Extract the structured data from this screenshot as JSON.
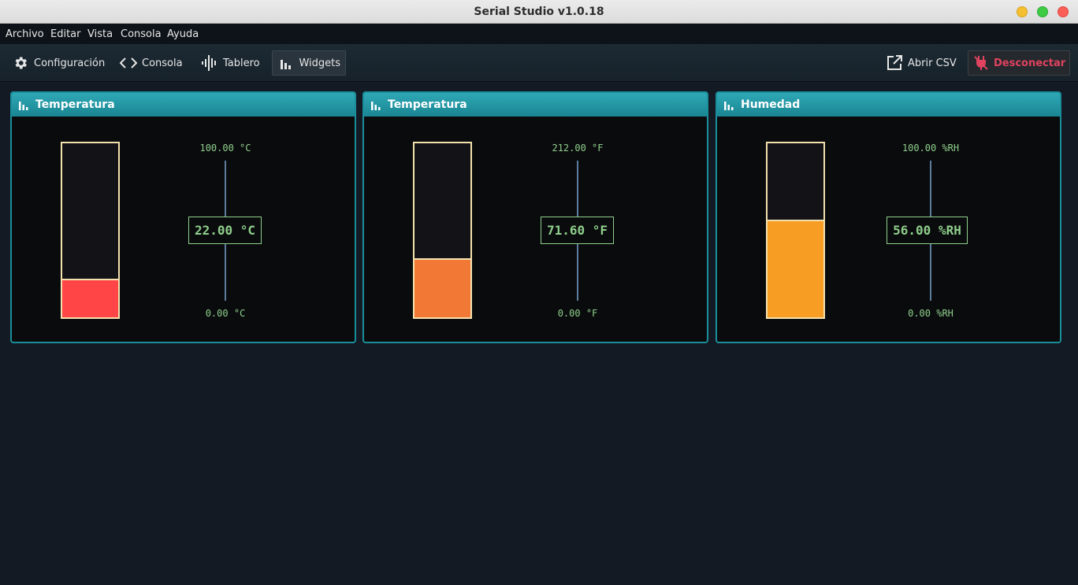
{
  "window": {
    "title": "Serial Studio v1.0.18"
  },
  "menu": [
    "Archivo",
    "Editar",
    "Vista",
    "Consola",
    "Ayuda"
  ],
  "toolbar": {
    "config": "Configuración",
    "console": "Consola",
    "dashboard": "Tablero",
    "widgets": "Widgets",
    "open_csv": "Abrir CSV",
    "disconnect": "Desconectar"
  },
  "widgets": [
    {
      "title": "Temperatura",
      "max_label": "100.00 °C",
      "min_label": "0.00 °C",
      "value_label": "22.00 °C",
      "level": 0.22,
      "color": "#ff4545"
    },
    {
      "title": "Temperatura",
      "max_label": "212.00 °F",
      "min_label": "0.00 °F",
      "value_label": "71.60 °F",
      "level": 0.338,
      "color": "#f27935"
    },
    {
      "title": "Humedad",
      "max_label": "100.00 %RH",
      "min_label": "0.00 %RH",
      "value_label": "56.00 %RH",
      "level": 0.56,
      "color": "#f89d24"
    }
  ],
  "colors": {
    "panel_border": "#1a8e9b",
    "tank_border": "#f3e0ad",
    "label_green": "#8fcf8c",
    "disconnect_red": "#e0425f"
  }
}
